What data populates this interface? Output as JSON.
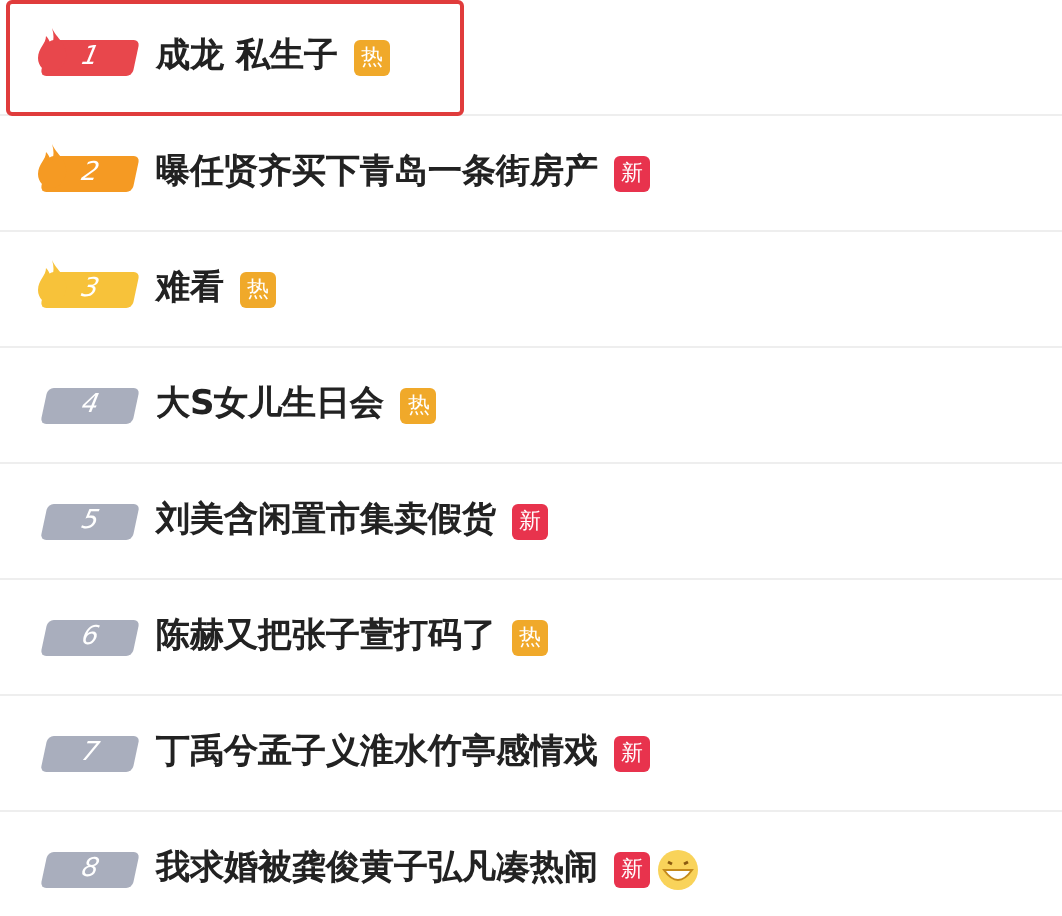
{
  "items": [
    {
      "rank": "1",
      "title": "成龙 私生子",
      "flame": true,
      "color": "#e8474c",
      "highlighted": true,
      "tag": {
        "text": "热",
        "kind": "hot"
      },
      "emoji": false
    },
    {
      "rank": "2",
      "title": "曝任贤齐买下青岛一条街房产",
      "flame": true,
      "color": "#f59a23",
      "highlighted": false,
      "tag": {
        "text": "新",
        "kind": "new"
      },
      "emoji": false
    },
    {
      "rank": "3",
      "title": "难看",
      "flame": true,
      "color": "#f7c23a",
      "highlighted": false,
      "tag": {
        "text": "热",
        "kind": "hot"
      },
      "emoji": false
    },
    {
      "rank": "4",
      "title": "大S女儿生日会",
      "flame": false,
      "color": "#a9aebd",
      "highlighted": false,
      "tag": {
        "text": "热",
        "kind": "hot"
      },
      "emoji": false
    },
    {
      "rank": "5",
      "title": "刘美含闲置市集卖假货",
      "flame": false,
      "color": "#a9aebd",
      "highlighted": false,
      "tag": {
        "text": "新",
        "kind": "new"
      },
      "emoji": false
    },
    {
      "rank": "6",
      "title": "陈赫又把张子萱打码了",
      "flame": false,
      "color": "#a9aebd",
      "highlighted": false,
      "tag": {
        "text": "热",
        "kind": "hot"
      },
      "emoji": false
    },
    {
      "rank": "7",
      "title": "丁禹兮孟子义淮水竹亭感情戏",
      "flame": false,
      "color": "#a9aebd",
      "highlighted": false,
      "tag": {
        "text": "新",
        "kind": "new"
      },
      "emoji": false
    },
    {
      "rank": "8",
      "title": "我求婚被龚俊黄子弘凡凑热闹",
      "flame": false,
      "color": "#a9aebd",
      "highlighted": false,
      "tag": {
        "text": "新",
        "kind": "new"
      },
      "emoji": true
    }
  ]
}
